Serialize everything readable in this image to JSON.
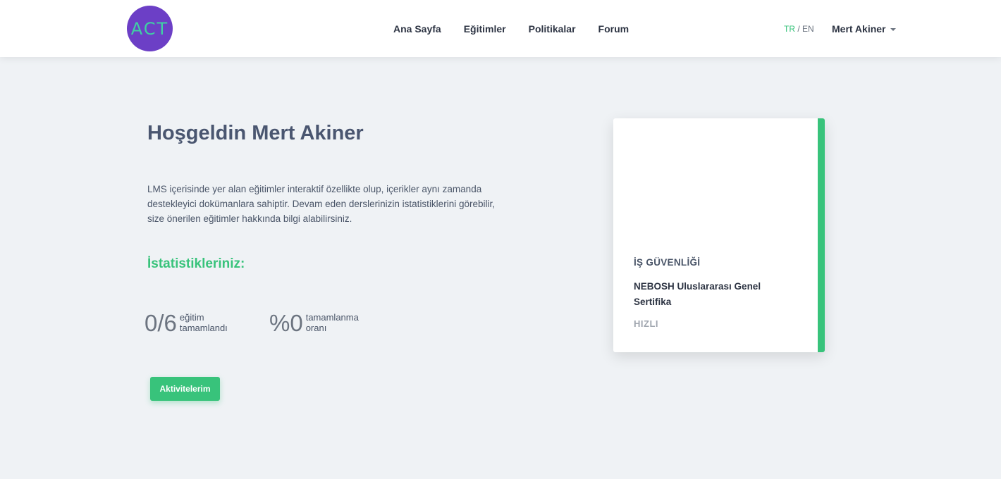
{
  "header": {
    "logo_text": "ACT",
    "nav": [
      "Ana Sayfa",
      "Eğitimler",
      "Politikalar",
      "Forum"
    ],
    "lang_active": "TR",
    "lang_separator": "/",
    "lang_other": "EN",
    "user_name": "Mert Akiner"
  },
  "main": {
    "welcome": "Hoşgeldin Mert Akiner",
    "intro": "LMS içerisinde yer alan eğitimler interaktif özellikte olup, içerikler aynı zamanda destekleyici dokümanlara sahiptir. Devam eden derslerinizin istatistiklerini görebilir, size önerilen eğitimler hakkında bilgi alabilirsiniz.",
    "stats_title": "İstatistikleriniz:",
    "stats": [
      {
        "value": "0/6",
        "label_line1": "eğitim",
        "label_line2": "tamamlandı"
      },
      {
        "value": "%0",
        "label_line1": "tamamlanma",
        "label_line2": "oranı"
      }
    ],
    "activities_button": "Aktivitelerim"
  },
  "card": {
    "category": "İŞ GÜVENLİĞİ",
    "course_title": "NEBOSH Uluslararası Genel Sertifika",
    "level": "HIZLI",
    "accent_color": "#38c37b"
  },
  "colors": {
    "accent": "#38c37b",
    "logo_bg": "#6c3fc6",
    "logo_text": "#3fd1a3",
    "page_bg": "#eff2f5"
  }
}
